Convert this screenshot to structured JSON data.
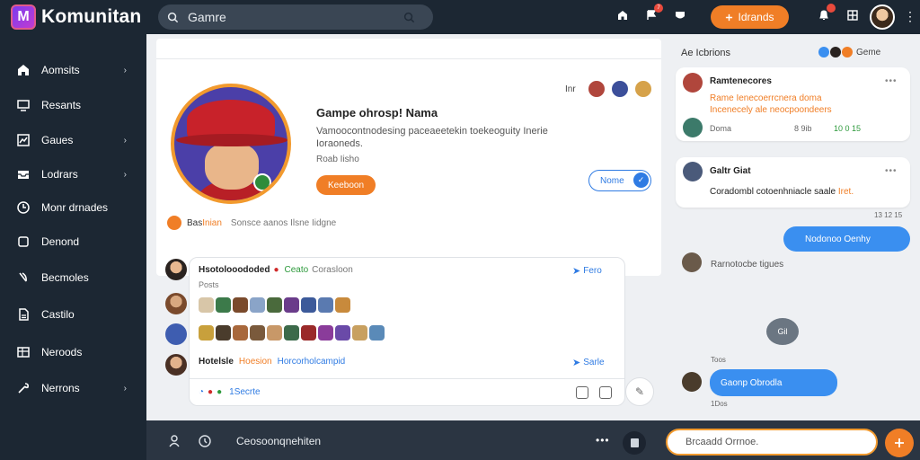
{
  "app": {
    "name": "Komunitan",
    "logo_letter": "M"
  },
  "search": {
    "placeholder": "Gamre"
  },
  "topbar": {
    "cta_label": "Idrands",
    "icons": [
      "home-icon",
      "flag-icon",
      "shield-icon",
      "bell-icon",
      "grid-icon",
      "kebab-icon"
    ],
    "badge": "7"
  },
  "sidebar": {
    "items": [
      {
        "label": "Aomsits",
        "icon": "home-icon",
        "chevron": true
      },
      {
        "label": "Resants",
        "icon": "monitor-icon",
        "chevron": false
      },
      {
        "label": "Gaues",
        "icon": "chart-icon",
        "chevron": true
      },
      {
        "label": "Lodrars",
        "icon": "inbox-icon",
        "chevron": true
      },
      {
        "label": "Monr drnades",
        "icon": "compass-icon",
        "chevron": false
      },
      {
        "label": "Denond",
        "icon": "square-icon",
        "chevron": false
      },
      {
        "label": "Becmoles",
        "icon": "link-icon",
        "chevron": false
      },
      {
        "label": "Castilo",
        "icon": "document-icon",
        "chevron": false
      },
      {
        "label": "Neroods",
        "icon": "table-icon",
        "chevron": false
      },
      {
        "label": "Nerrons",
        "icon": "wrench-icon",
        "chevron": true
      }
    ]
  },
  "profile": {
    "title": "Gampe ohrosp! Nama",
    "description": "Vamoocontnodesing paceaeetekin toekeoguity Inerie Ioraoneds.",
    "sub_label": "Roab Iisho",
    "primary_button": "Keeboon",
    "members_label": "Inr",
    "follow_button": "Nome",
    "footer": {
      "label": "Bas",
      "highlight": "Inian",
      "muted": "Sonsce aanos Ilsne Iidgne"
    }
  },
  "feed": {
    "post1": {
      "name": "Hsotolooododed",
      "green": "Ceato",
      "muted": "Corasloon",
      "sub": "Posts",
      "action": "Fero"
    },
    "post2": {
      "name": "Hotelsle",
      "orange": "Hoesion",
      "blue": "Horcorholcampid",
      "action": "Sarle"
    },
    "comment_count": "1Secrte"
  },
  "bottombar": {
    "text": "Ceosoonqnehiten",
    "dots": "•••",
    "input_placeholder": "Brcaadd Orrnoe."
  },
  "chat": {
    "header": "Ae Icbrions",
    "header_right": "Geme",
    "card1": {
      "title": "Ramtenecores",
      "text": "Rame Ienecoerrcnera doma Incenecely ale neocpoondeers",
      "meta_left": "Doma",
      "meta_mid": "8 9ib",
      "meta_right": "10 0 15",
      "dots": "•••"
    },
    "card2": {
      "title": "Galtr Giat",
      "text": "Coradombl cotoenhniacle saale",
      "text_hl": "Iret.",
      "dots": "•••",
      "timestamp": "13 12 15"
    },
    "bubble1": "Nodonoo Oenhy",
    "row1": "Rarnotocbe tigues",
    "bubble_gray": "Gil",
    "label_above": "Toos",
    "bubble2": "Gaonp Obrodla",
    "label_below": "1Dos"
  },
  "colors": {
    "accent": "#f07e26",
    "brand_dark": "#1c2733",
    "link_blue": "#2f7be3",
    "bubble_blue": "#3a8ff0"
  }
}
